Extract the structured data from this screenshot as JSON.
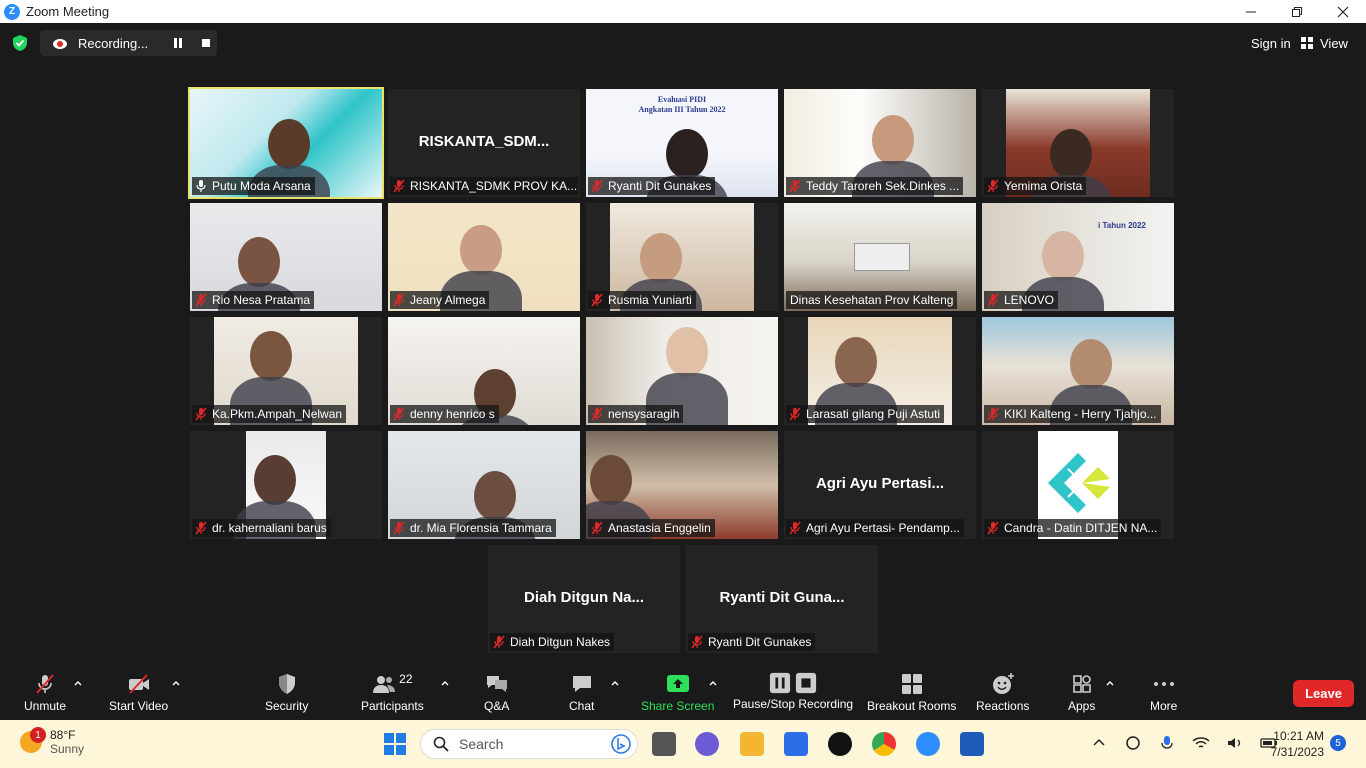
{
  "window": {
    "title": "Zoom Meeting"
  },
  "topbar": {
    "recording_label": "Recording...",
    "signin_label": "Sign in",
    "view_label": "View"
  },
  "participants": [
    {
      "name": "Putu Moda Arsana",
      "active": true,
      "video": true
    },
    {
      "name": "RISKANTA_SDMK PROV KA...",
      "big": "RISKANTA_SDM...",
      "video": false
    },
    {
      "name": "Ryanti Dit Gunakes",
      "video": true,
      "banner_title": "Evaluasi PIDI",
      "banner_sub": "Angkatan III Tahun 2022"
    },
    {
      "name": "Teddy Taroreh Sek.Dinkes ...",
      "video": true
    },
    {
      "name": "Yemima Orista",
      "video": true
    },
    {
      "name": "Rio Nesa Pratama",
      "video": true
    },
    {
      "name": "Jeany Almega",
      "video": true
    },
    {
      "name": "Rusmia Yuniarti",
      "video": true
    },
    {
      "name": "Dinas Kesehatan Prov Kalteng",
      "video": true,
      "nomic": true
    },
    {
      "name": "LENOVO",
      "video": true,
      "banner_text": "i Tahun 2022"
    },
    {
      "name": "Ka.Pkm.Ampah_Nelwan",
      "video": true
    },
    {
      "name": "denny henrico s",
      "video": true
    },
    {
      "name": "nensysaragih",
      "video": true
    },
    {
      "name": "Larasati gilang Puji Astuti",
      "video": true
    },
    {
      "name": "KIKI Kalteng - Herry Tjahjo...",
      "video": true
    },
    {
      "name": "dr. kahernaliani barus",
      "video": true
    },
    {
      "name": "dr. Mia Florensia Tammara",
      "video": true
    },
    {
      "name": "Anastasia Enggelin",
      "video": true
    },
    {
      "name": "Agri Ayu Pertasi- Pendamp...",
      "big": "Agri Ayu Pertasi...",
      "video": false
    },
    {
      "name": "Candra - Datin DITJEN NA...",
      "video": true
    },
    {
      "name": "Diah Ditgun Nakes",
      "big": "Diah Ditgun Na...",
      "video": false
    },
    {
      "name": "Ryanti Dit Gunakes",
      "big": "Ryanti Dit Guna...",
      "video": false
    }
  ],
  "toolbar": {
    "unmute": "Unmute",
    "start_video": "Start Video",
    "security": "Security",
    "participants": "Participants",
    "participants_count": "22",
    "qa": "Q&A",
    "chat": "Chat",
    "share_screen": "Share Screen",
    "pause_stop": "Pause/Stop Recording",
    "breakout": "Breakout Rooms",
    "reactions": "Reactions",
    "apps": "Apps",
    "more": "More",
    "leave": "Leave"
  },
  "taskbar": {
    "weather_temp": "88°F",
    "weather_desc": "Sunny",
    "weather_badge": "1",
    "search_placeholder": "Search",
    "time": "10:21 AM",
    "date": "7/31/2023",
    "notif_count": "5"
  },
  "colors": {
    "accent": "#2d8cff",
    "active_speaker": "#e9e36a",
    "share_green": "#2ee05a",
    "leave_red": "#e02828",
    "mic_red": "#e02828"
  }
}
